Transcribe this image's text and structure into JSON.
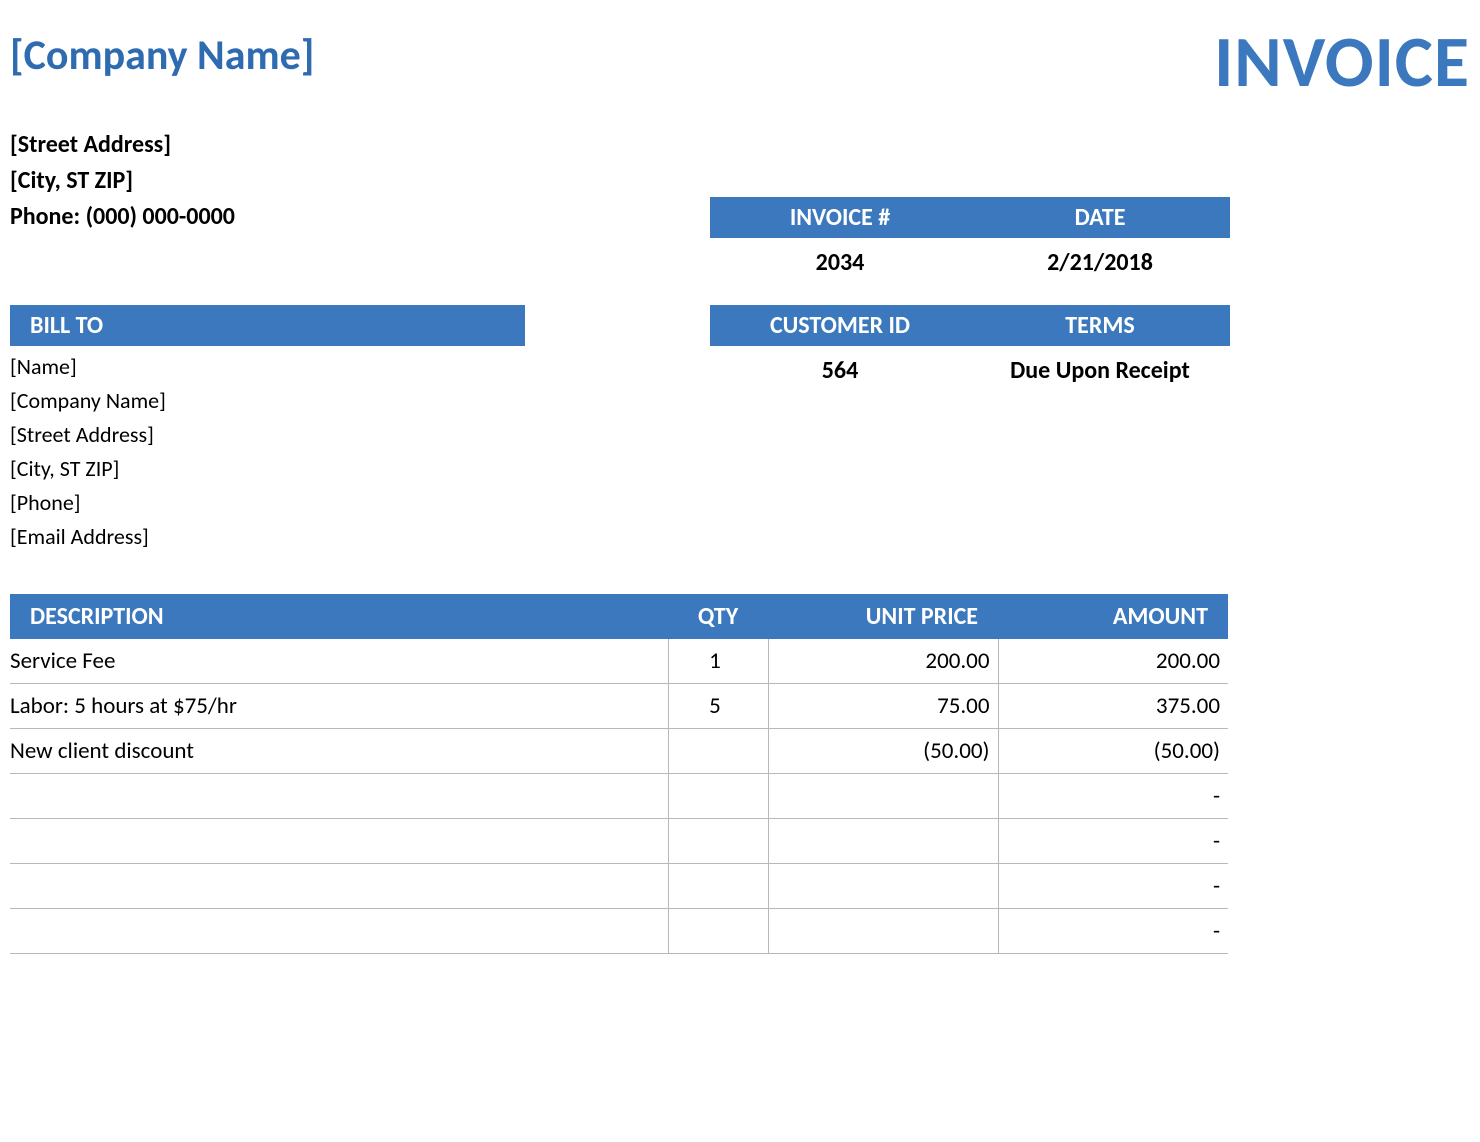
{
  "header": {
    "company_name": "[Company Name]",
    "invoice_title": "INVOICE",
    "street": "[Street Address]",
    "city": "[City, ST  ZIP]",
    "phone": "Phone: (000) 000-0000"
  },
  "meta1": {
    "invoice_num_label": "INVOICE #",
    "invoice_num_value": "2034",
    "date_label": "DATE",
    "date_value": "2/21/2018"
  },
  "bill_to": {
    "header": "BILL TO",
    "name": "[Name]",
    "company": "[Company Name]",
    "street": "[Street Address]",
    "city": "[City, ST  ZIP]",
    "phone": "[Phone]",
    "email": "[Email Address]"
  },
  "meta2": {
    "customer_id_label": "CUSTOMER ID",
    "customer_id_value": "564",
    "terms_label": "TERMS",
    "terms_value": "Due Upon Receipt"
  },
  "items": {
    "headers": {
      "description": "DESCRIPTION",
      "qty": "QTY",
      "unit_price": "UNIT PRICE",
      "amount": "AMOUNT"
    },
    "rows": [
      {
        "description": "Service Fee",
        "qty": "1",
        "unit_price": "200.00",
        "amount": "200.00"
      },
      {
        "description": "Labor: 5 hours at $75/hr",
        "qty": "5",
        "unit_price": "75.00",
        "amount": "375.00"
      },
      {
        "description": "New client discount",
        "qty": "",
        "unit_price": "(50.00)",
        "amount": "(50.00)"
      },
      {
        "description": "",
        "qty": "",
        "unit_price": "",
        "amount": "-"
      },
      {
        "description": "",
        "qty": "",
        "unit_price": "",
        "amount": "-"
      },
      {
        "description": "",
        "qty": "",
        "unit_price": "",
        "amount": "-"
      },
      {
        "description": "",
        "qty": "",
        "unit_price": "",
        "amount": "-"
      }
    ]
  }
}
